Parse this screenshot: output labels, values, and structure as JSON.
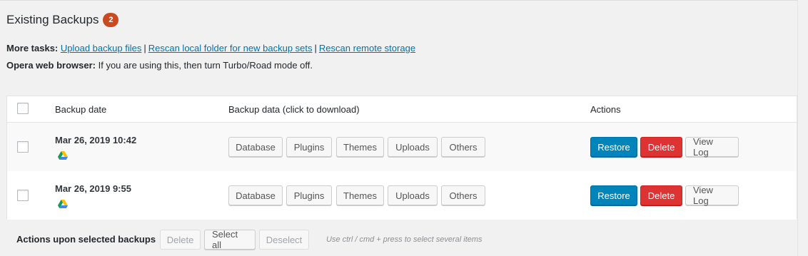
{
  "heading": {
    "title": "Existing Backups",
    "count": "2"
  },
  "tasks": {
    "label": "More tasks:",
    "links": [
      "Upload backup files",
      "Rescan local folder for new backup sets",
      "Rescan remote storage"
    ],
    "separator": "|"
  },
  "opera": {
    "label": "Opera web browser:",
    "text": "If you are using this, then turn Turbo/Road mode off."
  },
  "table": {
    "headers": {
      "date": "Backup date",
      "data": "Backup data (click to download)",
      "actions": "Actions"
    },
    "rows": [
      {
        "date": "Mar 26, 2019 10:42",
        "storage_icon": "google-drive-icon",
        "data_buttons": [
          "Database",
          "Plugins",
          "Themes",
          "Uploads",
          "Others"
        ],
        "actions": {
          "restore": "Restore",
          "delete": "Delete",
          "log": "View Log"
        }
      },
      {
        "date": "Mar 26, 2019 9:55",
        "storage_icon": "google-drive-icon",
        "data_buttons": [
          "Database",
          "Plugins",
          "Themes",
          "Uploads",
          "Others"
        ],
        "actions": {
          "restore": "Restore",
          "delete": "Delete",
          "log": "View Log"
        }
      }
    ]
  },
  "bulk": {
    "label": "Actions upon selected backups",
    "delete": "Delete",
    "select_all": "Select all",
    "deselect": "Deselect",
    "hint": "Use ctrl / cmd + press to select several items"
  },
  "colors": {
    "badge": "#ca4a1f",
    "primary": "#0085ba",
    "danger": "#dd3333",
    "link": "#0073aa"
  }
}
